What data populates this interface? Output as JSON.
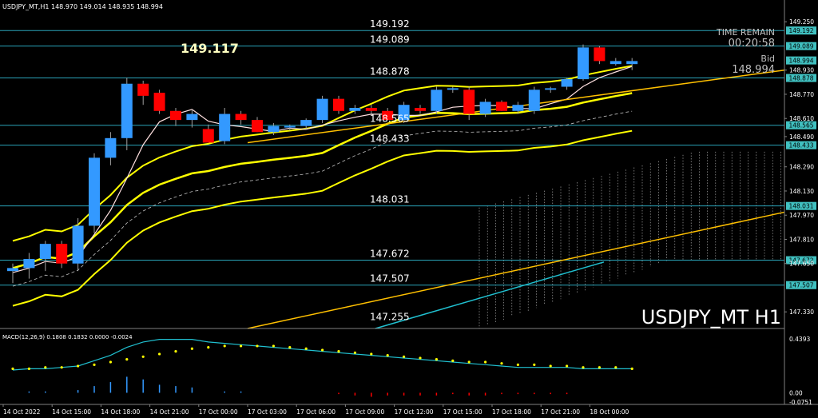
{
  "header": {
    "symbol_tf": "USDJPY_MT,H1",
    "ohlc": "148.970 149.014 148.935 148.994",
    "big_price": "149.117"
  },
  "info_box": {
    "time_remain_label": "TIME REMAIN",
    "time_remain_value": "00:20:58",
    "bid_label": "Bid",
    "bid_value": "148.994"
  },
  "watermark": "USDJPY_MT H1",
  "colors": {
    "background": "#000000",
    "bull": "#3399ff",
    "bear": "#ff0000",
    "yellow": "#ffff00",
    "orange": "#ffc000",
    "cyan": "#20c0d0",
    "level_line": "#2aa3b8",
    "price_box": "#40c0c0"
  },
  "chart_data": {
    "type": "candlestick",
    "symbol": "USDJPY_MT",
    "timeframe": "H1",
    "price_axis": {
      "min": 147.22,
      "max": 149.32,
      "ticks": [
        "149.250",
        "149.192",
        "149.089",
        "148.994",
        "148.930",
        "148.878",
        "148.770",
        "148.610",
        "148.565",
        "148.490",
        "148.433",
        "148.290",
        "148.130",
        "148.031",
        "147.970",
        "147.810",
        "147.672",
        "147.650",
        "147.507",
        "147.330"
      ],
      "tick_values": [
        149.25,
        149.192,
        149.089,
        148.994,
        148.93,
        148.878,
        148.77,
        148.61,
        148.565,
        148.49,
        148.433,
        148.29,
        148.13,
        148.031,
        147.97,
        147.81,
        147.672,
        147.65,
        147.507,
        147.33
      ],
      "boxed": [
        "149.192",
        "149.089",
        "148.994",
        "148.878",
        "148.565",
        "148.433",
        "148.031",
        "147.672",
        "147.507"
      ]
    },
    "levels": [
      149.192,
      149.089,
      148.878,
      148.565,
      148.433,
      148.031,
      147.672,
      147.507
    ],
    "level_labels": [
      "149.192",
      "149.089",
      "148.878",
      "148.565",
      "148.433",
      "148.031",
      "147.672",
      "147.507",
      "147.255"
    ],
    "level_label_values": [
      149.192,
      149.089,
      148.878,
      148.565,
      148.433,
      148.031,
      147.672,
      147.507,
      147.255
    ],
    "x_labels": [
      "14 Oct 2022",
      "14 Oct 15:00",
      "14 Oct 18:00",
      "14 Oct 21:00",
      "17 Oct 00:00",
      "17 Oct 03:00",
      "17 Oct 06:00",
      "17 Oct 09:00",
      "17 Oct 12:00",
      "17 Oct 15:00",
      "17 Oct 18:00",
      "17 Oct 21:00",
      "18 Oct 00:00"
    ],
    "candles": [
      [
        147.6,
        147.65,
        147.52,
        147.62
      ],
      [
        147.62,
        147.72,
        147.55,
        147.68
      ],
      [
        147.68,
        147.8,
        147.6,
        147.78
      ],
      [
        147.78,
        147.8,
        147.62,
        147.65
      ],
      [
        147.65,
        147.95,
        147.6,
        147.9
      ],
      [
        147.9,
        148.38,
        147.85,
        148.35
      ],
      [
        148.35,
        148.52,
        148.3,
        148.48
      ],
      [
        148.48,
        148.88,
        148.4,
        148.84
      ],
      [
        148.84,
        148.86,
        148.7,
        148.76
      ],
      [
        148.78,
        148.8,
        148.64,
        148.66
      ],
      [
        148.66,
        148.68,
        148.56,
        148.6
      ],
      [
        148.6,
        148.67,
        148.55,
        148.64
      ],
      [
        148.54,
        148.57,
        148.45,
        148.45
      ],
      [
        148.46,
        148.68,
        148.44,
        148.64
      ],
      [
        148.64,
        148.66,
        148.57,
        148.6
      ],
      [
        148.6,
        148.62,
        148.52,
        148.52
      ],
      [
        148.52,
        148.58,
        148.5,
        148.56
      ],
      [
        148.55,
        148.57,
        148.53,
        148.56
      ],
      [
        148.56,
        148.61,
        148.54,
        148.6
      ],
      [
        148.6,
        148.76,
        148.58,
        148.74
      ],
      [
        148.74,
        148.76,
        148.64,
        148.66
      ],
      [
        148.66,
        148.7,
        148.64,
        148.68
      ],
      [
        148.68,
        148.7,
        148.64,
        148.66
      ],
      [
        148.66,
        148.68,
        148.6,
        148.6
      ],
      [
        148.6,
        148.72,
        148.58,
        148.7
      ],
      [
        148.68,
        148.7,
        148.64,
        148.66
      ],
      [
        148.66,
        148.82,
        148.64,
        148.8
      ],
      [
        148.8,
        148.82,
        148.78,
        148.81
      ],
      [
        148.8,
        148.82,
        148.6,
        148.64
      ],
      [
        148.64,
        148.74,
        148.62,
        148.72
      ],
      [
        148.72,
        148.73,
        148.66,
        148.66
      ],
      [
        148.66,
        148.72,
        148.64,
        148.7
      ],
      [
        148.66,
        148.82,
        148.64,
        148.8
      ],
      [
        148.8,
        148.82,
        148.78,
        148.81
      ],
      [
        148.82,
        148.88,
        148.8,
        148.87
      ],
      [
        148.87,
        149.1,
        148.86,
        149.08
      ],
      [
        149.08,
        149.09,
        148.97,
        148.99
      ],
      [
        148.97,
        149.01,
        148.96,
        148.99
      ],
      [
        148.97,
        149.01,
        148.93,
        148.99
      ]
    ],
    "macd": {
      "label": "MACD(12,26,9) 0.1808 0.1832 0.0000 -0.0024",
      "axis_top": "0.4393",
      "axis_zero": "0.00",
      "axis_bottom": "-0.0751",
      "range": [
        -0.0751,
        0.4393
      ],
      "histogram": [
        0.0,
        0.01,
        0.01,
        0.0,
        0.02,
        0.05,
        0.08,
        0.12,
        0.1,
        0.06,
        0.05,
        0.04,
        0.0,
        0.01,
        0.01,
        0.0,
        0.0,
        0.0,
        0.0,
        0.0,
        -0.01,
        -0.02,
        -0.03,
        -0.02,
        -0.02,
        -0.02,
        -0.02,
        -0.01,
        -0.02,
        -0.02,
        -0.01,
        -0.01,
        -0.01,
        -0.01,
        -0.01,
        0.0,
        0.0,
        0.0,
        0.0
      ],
      "signal_line": [
        0.17,
        0.18,
        0.18,
        0.19,
        0.2,
        0.24,
        0.28,
        0.34,
        0.38,
        0.4,
        0.4,
        0.4,
        0.38,
        0.37,
        0.36,
        0.35,
        0.34,
        0.33,
        0.32,
        0.31,
        0.3,
        0.29,
        0.28,
        0.27,
        0.26,
        0.25,
        0.24,
        0.23,
        0.22,
        0.21,
        0.2,
        0.19,
        0.19,
        0.19,
        0.19,
        0.18,
        0.18,
        0.18,
        0.18
      ],
      "signal_dots": [
        0.18,
        0.18,
        0.19,
        0.19,
        0.2,
        0.21,
        0.23,
        0.25,
        0.27,
        0.29,
        0.31,
        0.33,
        0.34,
        0.35,
        0.35,
        0.35,
        0.35,
        0.34,
        0.33,
        0.32,
        0.31,
        0.3,
        0.29,
        0.28,
        0.27,
        0.26,
        0.25,
        0.24,
        0.23,
        0.23,
        0.22,
        0.21,
        0.21,
        0.2,
        0.2,
        0.19,
        0.19,
        0.19,
        0.18
      ]
    }
  }
}
